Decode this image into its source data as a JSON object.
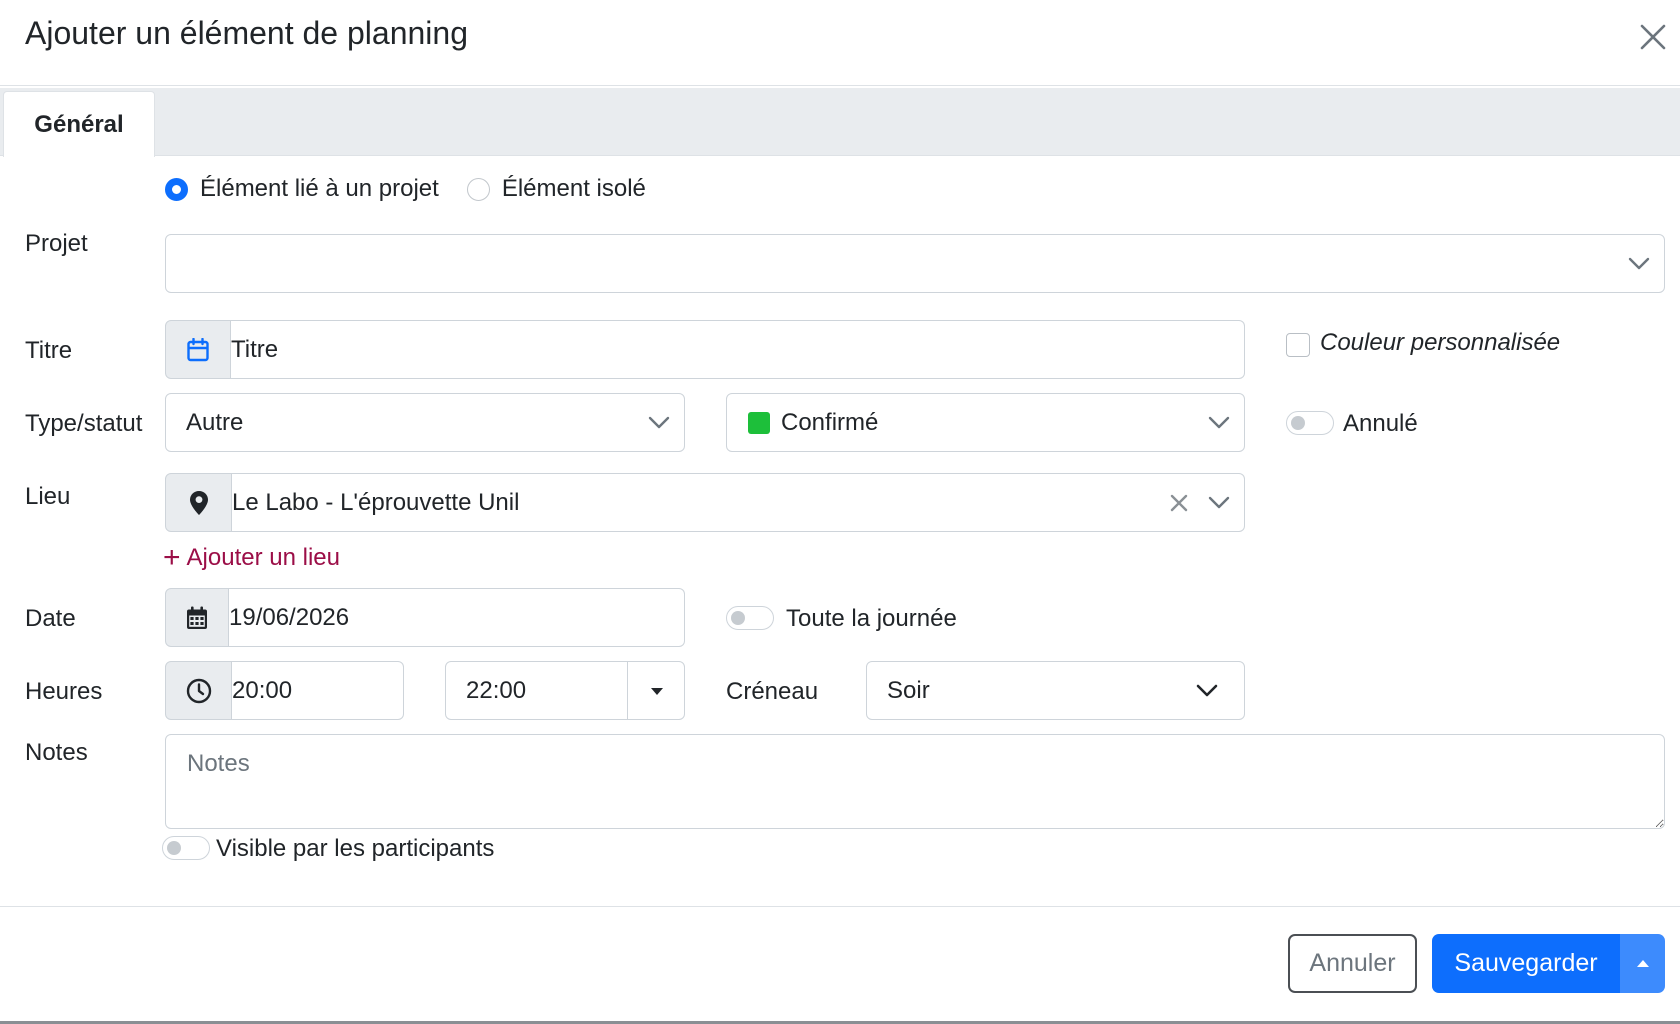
{
  "modal": {
    "title": "Ajouter un élément de planning"
  },
  "tabs": [
    {
      "label": "Général",
      "active": true
    }
  ],
  "link_type": {
    "options": [
      "Élément lié à un projet",
      "Élément isolé"
    ],
    "selected": "Élément lié à un projet"
  },
  "labels": {
    "projet": "Projet",
    "titre": "Titre",
    "type_statut": "Type/statut",
    "lieu": "Lieu",
    "date": "Date",
    "heures": "Heures",
    "creneau": "Créneau",
    "notes": "Notes"
  },
  "projet": {
    "value": ""
  },
  "titre": {
    "placeholder": "Titre",
    "value": ""
  },
  "custom_color": {
    "label": "Couleur personnalisée",
    "checked": false
  },
  "type": {
    "value": "Autre"
  },
  "statut": {
    "value": "Confirmé",
    "color": "#1dbf3a"
  },
  "annule": {
    "label": "Annulé",
    "on": false
  },
  "lieu": {
    "value": "Le Labo - L'éprouvette Unil"
  },
  "add_lieu": {
    "label": "Ajouter un lieu"
  },
  "date": {
    "value": "19/06/2026"
  },
  "all_day": {
    "label": "Toute la journée",
    "on": false
  },
  "heures": {
    "start": "20:00",
    "end": "22:00"
  },
  "creneau": {
    "value": "Soir"
  },
  "notes": {
    "placeholder": "Notes",
    "value": ""
  },
  "visible": {
    "label": "Visible par les participants",
    "on": false
  },
  "footer": {
    "cancel_label": "Annuler",
    "save_label": "Sauvegarder"
  },
  "colors": {
    "primary": "#0d6efd",
    "link": "#9b0e47",
    "status_confirmed": "#1dbf3a"
  }
}
